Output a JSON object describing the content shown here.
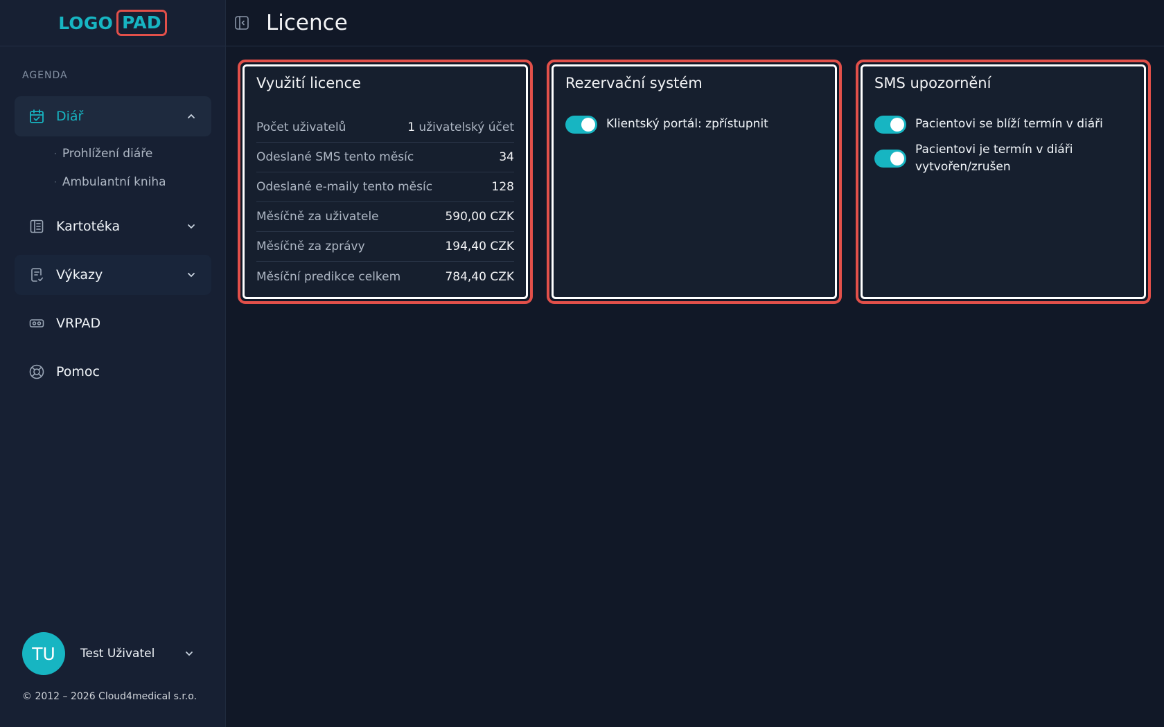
{
  "logo": {
    "part1": "LOGO",
    "part2": "PAD"
  },
  "sidebar": {
    "section_label": "AGENDA",
    "items": [
      {
        "label": "Diář",
        "icon": "calendar-check-icon",
        "expanded": true,
        "subitems": [
          "Prohlížení diáře",
          "Ambulantní kniha"
        ]
      },
      {
        "label": "Kartotéka",
        "icon": "index-card-icon"
      },
      {
        "label": "Výkazy",
        "icon": "report-icon"
      },
      {
        "label": "VRPAD",
        "icon": "vr-headset-icon"
      },
      {
        "label": "Pomoc",
        "icon": "lifebuoy-icon"
      }
    ],
    "user": {
      "initials": "TU",
      "name": "Test Uživatel"
    },
    "copyright": "© 2012 – 2026 Cloud4medical s.r.o."
  },
  "header": {
    "title": "Licence"
  },
  "cards": {
    "license": {
      "title": "Využití licence",
      "rows": [
        {
          "label": "Počet uživatelů",
          "value_num": "1",
          "value_unit": " uživatelský účet"
        },
        {
          "label": "Odeslané SMS tento měsíc",
          "value": "34"
        },
        {
          "label": "Odeslané e-maily tento měsíc",
          "value": "128"
        },
        {
          "label": "Měsíčně za uživatele",
          "value": "590,00 CZK"
        },
        {
          "label": "Měsíčně za zprávy",
          "value": "194,40 CZK"
        },
        {
          "label": "Měsíční predikce celkem",
          "value": "784,40 CZK"
        }
      ]
    },
    "reservation": {
      "title": "Rezervační systém",
      "toggles": [
        {
          "label": "Klientský portál: zpřístupnit",
          "on": true
        }
      ]
    },
    "sms": {
      "title": "SMS upozornění",
      "toggles": [
        {
          "label": "Pacientovi se blíží termín v diáři",
          "on": true
        },
        {
          "label": "Pacientovi je termín v diáři vytvořen/zrušen",
          "on": true
        }
      ]
    }
  },
  "colors": {
    "accent": "#17b5c2",
    "highlight": "#e2504a",
    "background": "#111827",
    "sidebar": "#172033"
  }
}
